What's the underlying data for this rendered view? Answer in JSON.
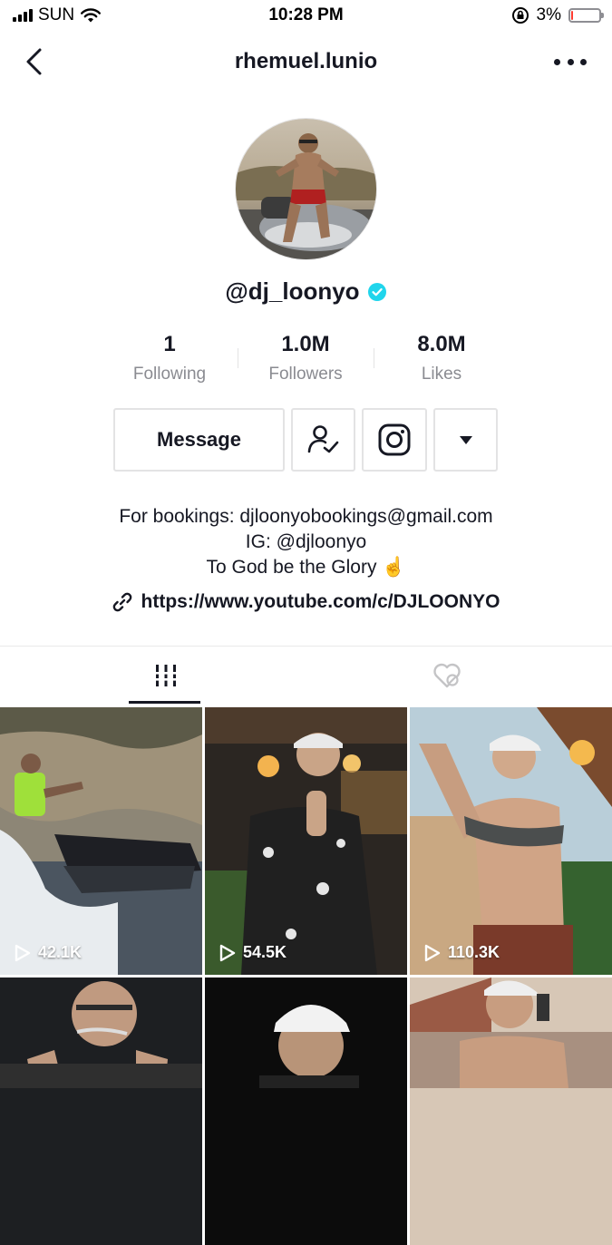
{
  "status_bar": {
    "carrier": "SUN",
    "time": "10:28 PM",
    "battery_percent": "3%",
    "battery_level": 0.03
  },
  "nav": {
    "title": "rhemuel.lunio",
    "back_icon": "chevron-left-icon",
    "more_icon": "ellipsis-icon"
  },
  "profile": {
    "handle": "@dj_loonyo",
    "verified_icon": "verified-check-icon"
  },
  "stats": [
    {
      "value": "1",
      "label": "Following"
    },
    {
      "value": "1.0M",
      "label": "Followers"
    },
    {
      "value": "8.0M",
      "label": "Likes"
    }
  ],
  "actions": {
    "message_label": "Message",
    "follow_icon": "user-check-icon",
    "instagram_icon": "instagram-icon",
    "dropdown_icon": "caret-down-icon"
  },
  "bio": {
    "line1": "For bookings: djloonyobookings@gmail.com",
    "line2": "IG: @djloonyo",
    "line3": "To God be the Glory ☝️"
  },
  "link": {
    "text": "https://www.youtube.com/c/DJLOONYO",
    "icon": "link-icon"
  },
  "tabs": [
    {
      "icon": "videos-grid-icon",
      "active": true
    },
    {
      "icon": "liked-hidden-icon",
      "active": false
    }
  ],
  "videos": [
    {
      "views": "42.1K"
    },
    {
      "views": "54.5K"
    },
    {
      "views": "110.3K"
    },
    {
      "views": ""
    },
    {
      "views": ""
    },
    {
      "views": ""
    }
  ],
  "colors": {
    "text": "#161823",
    "muted": "#8a8b91",
    "verified": "#20d5ec",
    "border": "#e3e3e4",
    "battery_low": "#ff3b30"
  }
}
